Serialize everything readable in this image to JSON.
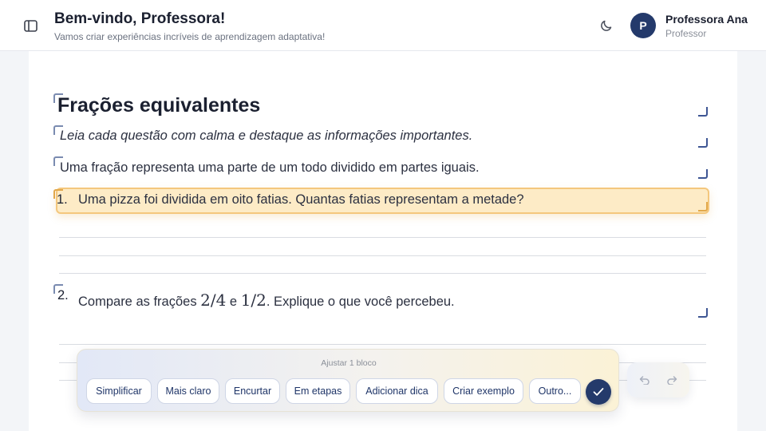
{
  "header": {
    "title": "Bem-vindo, Professora!",
    "subtitle": "Vamos criar experiências incríveis de aprendizagem adaptativa!",
    "user": {
      "initial": "P",
      "name": "Professora Ana",
      "role": "Professor"
    }
  },
  "document": {
    "title": "Frações equivalentes",
    "instruction": "Leia cada questão com calma e destaque as informações importantes.",
    "paragraph": "Uma fração representa uma parte de um todo dividido em partes iguais.",
    "questions": [
      {
        "number": "1.",
        "text": "Uma pizza foi dividida em oito fatias. Quantas fatias representam a metade?"
      },
      {
        "number": "2.",
        "text_before": "Compare as frações ",
        "fraction_a": "2/4",
        "connector": " e ",
        "fraction_b": "1/2",
        "text_after": ". Explique o que você percebeu."
      }
    ]
  },
  "toolbar": {
    "label": "Ajustar 1 bloco",
    "chips": [
      "Simplificar",
      "Mais claro",
      "Encurtar",
      "Em etapas",
      "Adicionar dica",
      "Criar exemplo",
      "Outro..."
    ]
  },
  "icons": {
    "sidebar": "sidebar-toggle-icon",
    "theme": "moon-icon",
    "confirm": "check-icon",
    "undo": "undo-icon",
    "redo": "redo-icon"
  },
  "colors": {
    "brand": "#243a6b",
    "highlight_bg": "#fdebc6",
    "highlight_border": "#f4c77d"
  }
}
